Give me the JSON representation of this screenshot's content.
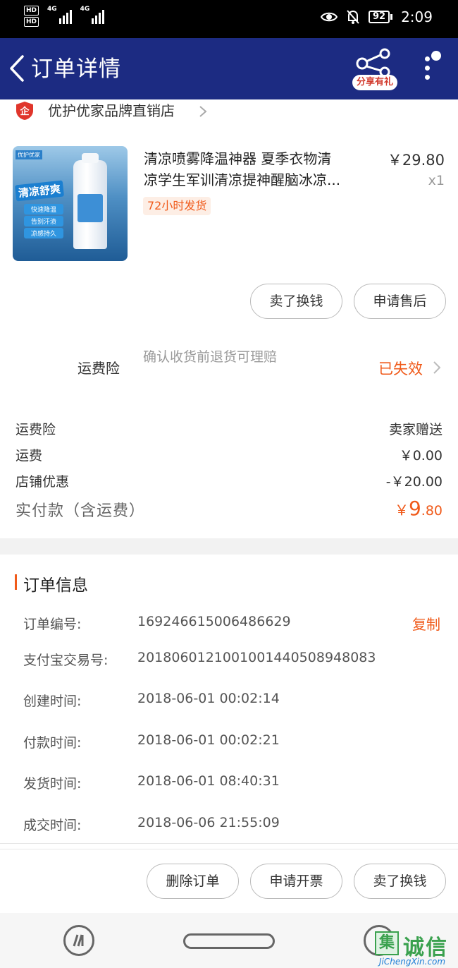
{
  "status_bar": {
    "hd1": "HD",
    "hd2": "HD",
    "net1": "4G",
    "net2": "4G",
    "battery": "92",
    "time": "2:09"
  },
  "header": {
    "title": "订单详情",
    "share_label": "分享有礼"
  },
  "shop": {
    "name": "优护优家品牌直销店"
  },
  "product": {
    "title_line1": "清凉喷雾降温神器 夏季衣物清",
    "title_line2": "凉学生军训清凉提神醒脑冰凉...",
    "shipping_tag": "72小时发货",
    "price": "￥29.80",
    "quantity": "x1",
    "image": {
      "brand": "优护优家",
      "headline": "清凉舒爽",
      "tags": [
        "快速降温",
        "告别汗渍",
        "凉感持久"
      ]
    },
    "actions": [
      "卖了换钱",
      "申请售后"
    ]
  },
  "insurance": {
    "label": "运费险",
    "description": "确认收货前退货可理赔",
    "status": "已失效"
  },
  "summary": {
    "rows": [
      {
        "label": "运费险",
        "value": "卖家赠送"
      },
      {
        "label": "运费",
        "value": "￥0.00"
      },
      {
        "label": "店铺优惠",
        "value": "-￥20.00"
      }
    ],
    "paid_label": "实付款（含运费）",
    "paid_currency": "￥",
    "paid_int": "9",
    "paid_dec": ".80"
  },
  "order_info": {
    "title": "订单信息",
    "copy_label": "复制",
    "rows": [
      {
        "label": "订单编号:",
        "value": "169246615006486629"
      },
      {
        "label": "支付宝交易号:",
        "value": "2018060121001001440508948083"
      },
      {
        "label": "创建时间:",
        "value": "2018-06-01 00:02:14"
      },
      {
        "label": "付款时间:",
        "value": "2018-06-01 00:02:21"
      },
      {
        "label": "发货时间:",
        "value": "2018-06-01 08:40:31"
      },
      {
        "label": "成交时间:",
        "value": "2018-06-06 21:55:09"
      }
    ]
  },
  "bottom_actions": [
    "删除订单",
    "申请开票",
    "卖了换钱"
  ],
  "watermark": {
    "box": "集",
    "text": "诚信",
    "url": "JiChengXin.com"
  },
  "colors": {
    "header_bg": "#1c2b82",
    "accent": "#f05a1a"
  }
}
